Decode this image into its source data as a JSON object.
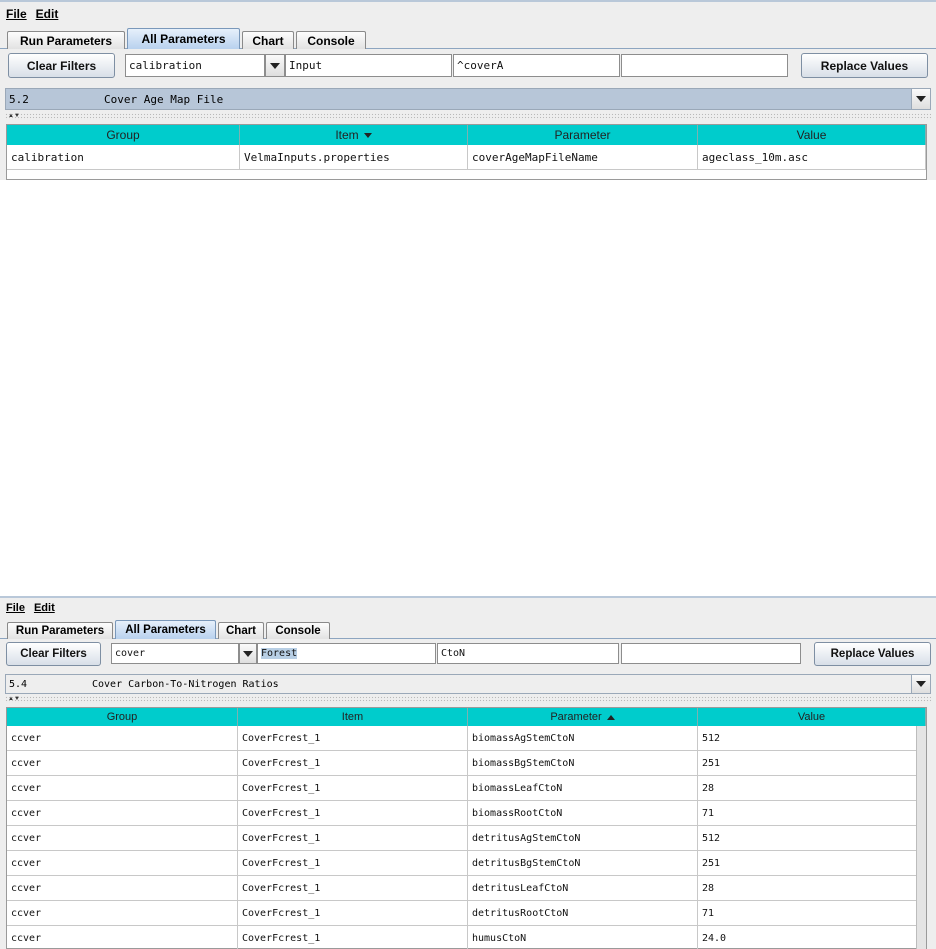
{
  "window1": {
    "menu": {
      "file": "File",
      "edit": "Edit"
    },
    "tabs": [
      {
        "label": "Run Parameters",
        "active": false
      },
      {
        "label": "All Parameters",
        "active": true
      },
      {
        "label": "Chart",
        "active": false
      },
      {
        "label": "Console",
        "active": false
      }
    ],
    "filters": {
      "clear_label": "Clear Filters",
      "group_value": "calibration",
      "item_value": "Input",
      "parameter_value": "^coverA",
      "value_value": "",
      "replace_label": "Replace Values"
    },
    "description": {
      "number": "5.2",
      "text": "Cover Age Map File"
    },
    "table": {
      "headers": [
        "Group",
        "Item",
        "Parameter",
        "Value"
      ],
      "sort_column": "Item",
      "sort_direction": "desc",
      "rows": [
        [
          "calibration",
          "VelmaInputs.properties",
          "coverAgeMapFileName",
          "ageclass_10m.asc"
        ]
      ]
    }
  },
  "window2": {
    "menu": {
      "file": "File",
      "edit": "Edit"
    },
    "tabs": [
      {
        "label": "Run Parameters",
        "active": false
      },
      {
        "label": "All Parameters",
        "active": true
      },
      {
        "label": "Chart",
        "active": false
      },
      {
        "label": "Console",
        "active": false
      }
    ],
    "filters": {
      "clear_label": "Clear Filters",
      "group_value": "cover",
      "item_value": "Forest",
      "parameter_value": "CtoN",
      "value_value": "",
      "replace_label": "Replace Values"
    },
    "description": {
      "number": "5.4",
      "text": "Cover Carbon-To-Nitrogen Ratios"
    },
    "table": {
      "headers": [
        "Group",
        "Item",
        "Parameter",
        "Value"
      ],
      "sort_column": "Parameter",
      "sort_direction": "asc",
      "rows": [
        [
          "ccver",
          "CoverFcrest_1",
          "biomassAgStemCtoN",
          "512"
        ],
        [
          "ccver",
          "CoverFcrest_1",
          "biomassBgStemCtoN",
          "251"
        ],
        [
          "ccver",
          "CoverFcrest_1",
          "biomassLeafCtoN",
          "28"
        ],
        [
          "ccver",
          "CoverFcrest_1",
          "biomassRootCtoN",
          "71"
        ],
        [
          "ccver",
          "CoverFcrest_1",
          "detritusAgStemCtoN",
          "512"
        ],
        [
          "ccver",
          "CoverFcrest_1",
          "detritusBgStemCtoN",
          "251"
        ],
        [
          "ccver",
          "CoverFcrest_1",
          "detritusLeafCtoN",
          "28"
        ],
        [
          "ccver",
          "CoverFcrest_1",
          "detritusRootCtoN",
          "71"
        ],
        [
          "ccver",
          "CoverFcrest_1",
          "humusCtoN",
          "24.0"
        ]
      ]
    }
  },
  "colors": {
    "header_cyan": "#00cccc",
    "active_tab": "#b8d1ee",
    "description_highlight": "#b7c6d8"
  }
}
